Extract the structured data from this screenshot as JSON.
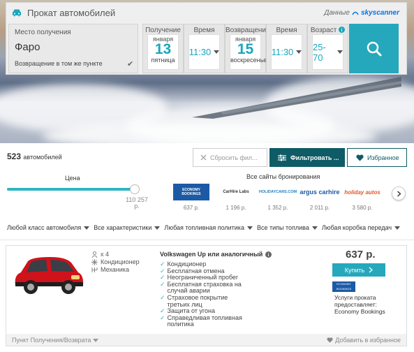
{
  "widget": {
    "title": "Прокат автомобилей",
    "powered_by": "Данные",
    "powered_brand": "skyscanner",
    "pickup_label": "Место получения",
    "pickup_value": "Фаро",
    "same_return": "Возвращение в том же пункте",
    "same_return_checked": true,
    "pickup_date_label": "Получение",
    "pickup_month": "января",
    "pickup_day": "13",
    "pickup_weekday": "пятница",
    "time_label": "Время",
    "pickup_time": "11:30",
    "return_date_label": "Возвращение",
    "return_month": "января",
    "return_day": "15",
    "return_weekday": "воскресенье",
    "return_time": "11:30",
    "age_label": "Возраст",
    "age_value": "25-70",
    "search_icon": "search-icon"
  },
  "results": {
    "count": "523",
    "count_suffix": "автомобилей",
    "reset_label": "Сбросить фил...",
    "filter_label": "Фильтровать ...",
    "favorites_label": "Избранное"
  },
  "price_filter": {
    "label": "Цена",
    "max_value": "110 257 р.",
    "fill_fraction": 1.0
  },
  "sites": {
    "label": "Все сайты бронирования",
    "items": [
      {
        "name": "ECONOMY BOOKINGS",
        "price": "637 р."
      },
      {
        "name": "CarHire Labs",
        "price": "1 196 р."
      },
      {
        "name": "HOLIDAYCARS.COM",
        "price": "1 352 р."
      },
      {
        "name": "argus carhire",
        "price": "2 011 р."
      },
      {
        "name": "holiday autos",
        "price": "3 580 р."
      }
    ]
  },
  "filters": [
    "Любой класс автомобиля",
    "Все характеристики",
    "Любая топливная политика",
    "Все типы топлива",
    "Любая коробка передач"
  ],
  "card": {
    "seats": "x 4",
    "ac": "Кондиционер",
    "transmission": "Механика",
    "model": "Volkswagen Up или аналогичный",
    "features": [
      "Кондиционер",
      "Бесплатная отмена",
      "Неограниченный пробег",
      "Бесплатная страховка на случай аварии",
      "Страховое покрытие третьих лиц",
      "Защита от угона",
      "Справедливая топливная политика"
    ],
    "price": "637 р.",
    "buy_label": "Купить",
    "provider_logo": "ECONOMY BOOKINGS",
    "provider_text": "Услуги проката предоставляет: Economy Bookings",
    "footer_left": "Пункт Получения/Возврата",
    "footer_right": "Добавить в избранное",
    "car_color": "#d0121b"
  },
  "colors": {
    "accent": "#25a8bc",
    "dark_teal": "#0f5b66"
  }
}
